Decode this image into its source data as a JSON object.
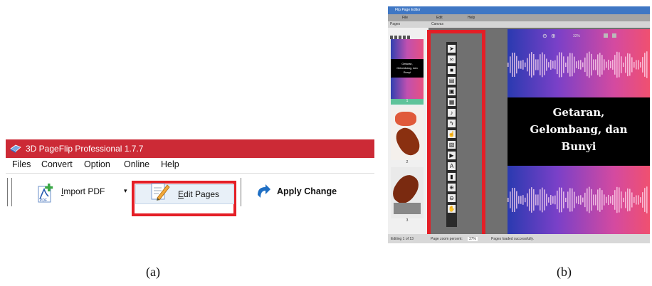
{
  "panel_a": {
    "title": "3D PageFlip Professional 1.7.7",
    "menu": [
      "Files",
      "Convert",
      "Option",
      "Online",
      "Help"
    ],
    "toolbar": {
      "import_pre": "",
      "import_ul": "I",
      "import_post": "mport PDF",
      "edit_ul": "E",
      "edit_post": "dit Pages",
      "apply_label": "Apply Change"
    },
    "icons": [
      "book-icon",
      "pdf-plus-icon",
      "dropdown-arrow-icon",
      "edit-pencil-icon",
      "refresh-arrow-icon"
    ],
    "highlight_color": "#e41e26",
    "title_color": "#cc2a36",
    "caption": "(a)"
  },
  "panel_b": {
    "title": "Flip Page Editor",
    "menu": [
      "File",
      "Edit",
      "Help"
    ],
    "sections": [
      "Pages",
      "Canvas"
    ],
    "zoom": "32%",
    "page_text": [
      "Getaran,",
      "Gelombang, dan",
      "Bunyi"
    ],
    "thumb_text": [
      "Getaran,",
      "Gelombang, dan",
      "Bunyi"
    ],
    "thumb_numbers": [
      "1",
      "2",
      "3"
    ],
    "status": {
      "left": "Editing 1 of 13",
      "zoom_label": "Page zoom percent:",
      "zoom_value": "37%",
      "message": "Pages loaded successfully."
    },
    "tools": [
      "cursor-icon",
      "link-icon",
      "video-icon",
      "film-icon",
      "image-icon",
      "gallery-icon",
      "audio-icon",
      "flash-icon",
      "button-icon",
      "picture-icon",
      "youtube-icon",
      "text-icon",
      "shape-icon",
      "zoom-in-icon",
      "zoom-out-icon",
      "hand-icon"
    ],
    "caption": "(b)"
  }
}
